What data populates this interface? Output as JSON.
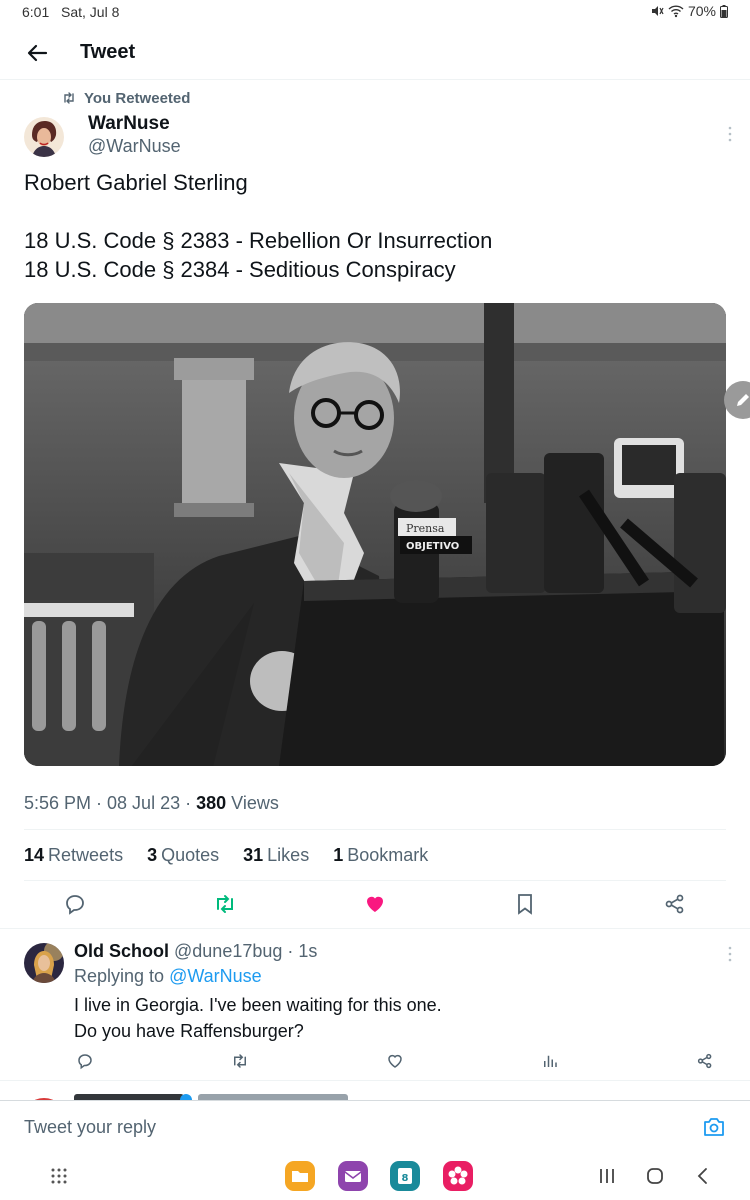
{
  "status": {
    "time": "6:01",
    "date": "Sat, Jul 8",
    "battery": "70%"
  },
  "header": {
    "title": "Tweet"
  },
  "tweet": {
    "retweet_label": "You Retweeted",
    "author_name": "WarNuse",
    "author_handle": "@WarNuse",
    "text": "Robert Gabriel Sterling\n\n18 U.S. Code § 2383 - Rebellion Or Insurrection\n18 U.S. Code § 2384 - Seditious Conspiracy",
    "media_signs": {
      "sign_1": "Prensa",
      "sign_2": "OBJETIVO"
    },
    "time": "5:56 PM · 08 Jul 23 · ",
    "views_count": "380",
    "views_label": " Views",
    "stats": [
      {
        "count": "14",
        "label": "Retweets"
      },
      {
        "count": "3",
        "label": "Quotes"
      },
      {
        "count": "31",
        "label": "Likes"
      },
      {
        "count": "1",
        "label": "Bookmark"
      }
    ]
  },
  "reply": {
    "name": "Old School",
    "handle_time": " @dune17bug · 1s",
    "replying_prefix": "Replying to ",
    "replying_handle": "@WarNuse",
    "text": "I live in Georgia.  I've been waiting for this one.\nDo you have Raffensburger?"
  },
  "composer": {
    "placeholder": "Tweet your reply"
  },
  "dock": {
    "calendar_day": "8"
  },
  "colors": {
    "accent": "#1d9bf0",
    "retweet_green": "#00ba7c",
    "like_pink": "#f91880",
    "secondary_text": "#536471"
  },
  "icons": [
    "back-arrow-icon",
    "retweet-icon",
    "more-icon",
    "edit-icon",
    "reply-icon",
    "like-icon",
    "bookmark-icon",
    "share-icon",
    "analytics-icon",
    "camera-icon"
  ]
}
